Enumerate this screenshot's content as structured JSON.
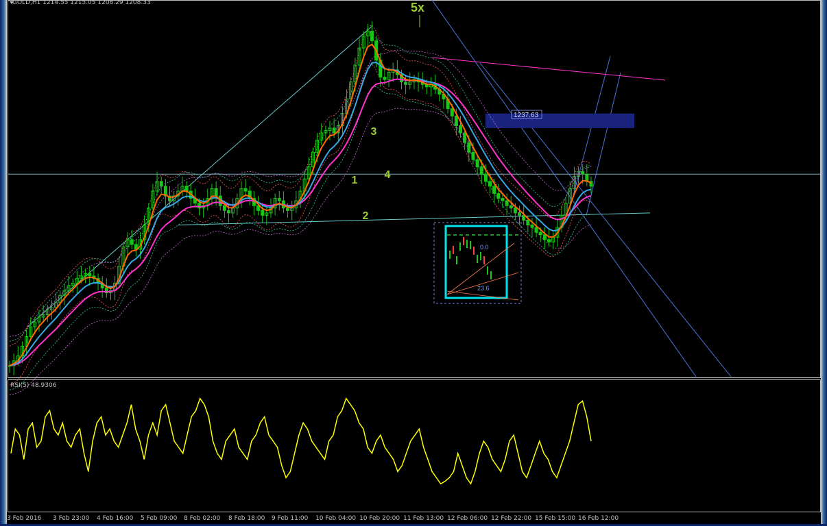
{
  "window": {
    "symbol_header": "GOLD,H1  1214.55  1215.05  1208.29  1208.33",
    "rsi_header": "RSI(5)  48.9306"
  },
  "colors": {
    "background": "#000000",
    "candle": "#19c619",
    "ema_fast": "#ff6a00",
    "ema_mid": "#35a8e6",
    "ema_slow": "#ff33cc",
    "rsi_line": "#ffff00",
    "wave_label": "#9acd32",
    "supply_zone": "#1a237e",
    "fib_box": "#00e5ee"
  },
  "annotations": {
    "wave_labels": [
      "1",
      "2",
      "3",
      "4",
      "5x"
    ],
    "price_tag": "1237.63",
    "fib_labels": [
      "0.0",
      "23.6"
    ]
  },
  "chart_data": [
    {
      "type": "candlestick",
      "title": "GOLD,H1",
      "x_tick_labels": [
        "3 Feb 2016",
        "3 Feb 23:00",
        "4 Feb 16:00",
        "5 Feb 09:00",
        "8 Feb 02:00",
        "8 Feb 18:00",
        "9 Feb 11:00",
        "10 Feb 04:00",
        "10 Feb 20:00",
        "11 Feb 13:00",
        "12 Feb 06:00",
        "12 Feb 22:00",
        "15 Feb 15:00",
        "16 Feb 12:00"
      ],
      "close": [
        1134,
        1136,
        1138,
        1142,
        1146,
        1150,
        1152,
        1154,
        1155,
        1157,
        1158,
        1160,
        1163,
        1165,
        1167,
        1168,
        1170,
        1171,
        1172,
        1171,
        1170,
        1168,
        1166,
        1164,
        1165,
        1168,
        1175,
        1183,
        1186,
        1184,
        1182,
        1186,
        1192,
        1199,
        1206,
        1210,
        1208,
        1204,
        1202,
        1204,
        1206,
        1208,
        1206,
        1203,
        1201,
        1199,
        1200,
        1203,
        1207,
        1204,
        1200,
        1198,
        1197,
        1199,
        1203,
        1207,
        1206,
        1203,
        1200,
        1198,
        1196,
        1197,
        1199,
        1203,
        1202,
        1199,
        1198,
        1199,
        1202,
        1206,
        1211,
        1216,
        1222,
        1227,
        1230,
        1231,
        1232,
        1230,
        1233,
        1238,
        1244,
        1251,
        1258,
        1265,
        1270,
        1272,
        1268,
        1260,
        1253,
        1252,
        1255,
        1256,
        1254,
        1251,
        1250,
        1251,
        1252,
        1251,
        1250,
        1249,
        1250,
        1248,
        1246,
        1244,
        1240,
        1237,
        1233,
        1230,
        1226,
        1222,
        1219,
        1216,
        1213,
        1210,
        1208,
        1205,
        1203,
        1202,
        1200,
        1199,
        1197,
        1196,
        1194,
        1192,
        1191,
        1189,
        1188,
        1186,
        1185,
        1187,
        1191,
        1196,
        1201,
        1207,
        1212,
        1214,
        1213,
        1210,
        1208
      ],
      "moving_averages": [
        "EMA fast",
        "EMA mid",
        "EMA slow"
      ],
      "levels": {
        "horizontal": 1213,
        "supply_zone": [
          1232,
          1238
        ],
        "price_tag": 1237.63
      },
      "ylim": [
        1130,
        1282
      ]
    },
    {
      "type": "line",
      "title": "RSI(5)",
      "current": 48.9306,
      "ylim": [
        0,
        100
      ],
      "values": [
        45,
        65,
        60,
        40,
        65,
        70,
        50,
        55,
        75,
        80,
        65,
        60,
        70,
        55,
        50,
        60,
        65,
        45,
        30,
        55,
        70,
        75,
        60,
        65,
        55,
        50,
        60,
        70,
        85,
        65,
        55,
        40,
        60,
        70,
        60,
        80,
        85,
        70,
        55,
        50,
        45,
        60,
        75,
        80,
        90,
        85,
        75,
        55,
        45,
        40,
        55,
        60,
        65,
        50,
        45,
        40,
        55,
        60,
        70,
        75,
        60,
        55,
        50,
        35,
        25,
        30,
        45,
        60,
        70,
        65,
        55,
        50,
        45,
        40,
        55,
        60,
        75,
        80,
        90,
        85,
        80,
        70,
        65,
        50,
        45,
        55,
        60,
        50,
        45,
        40,
        30,
        35,
        45,
        55,
        60,
        65,
        50,
        40,
        30,
        25,
        20,
        22,
        25,
        30,
        45,
        35,
        25,
        20,
        30,
        45,
        55,
        50,
        40,
        35,
        30,
        40,
        55,
        60,
        45,
        30,
        25,
        35,
        45,
        55,
        45,
        40,
        30,
        25,
        35,
        45,
        55,
        70,
        85,
        88,
        75,
        55
      ]
    }
  ]
}
